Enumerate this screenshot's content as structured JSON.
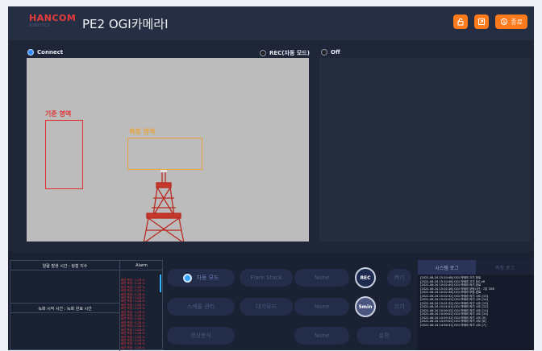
{
  "app": {
    "logo_text": "HANCOM",
    "logo_sub": "ROBOTICS",
    "title": "PE2 OGI카메라I"
  },
  "topbar": {
    "exit_label": "종료",
    "icons": [
      "lock-icon",
      "export-icon",
      "exit-icon"
    ]
  },
  "camera": {
    "connect_label": "Connect",
    "rec_label": "REC(자동 모드)",
    "off_label": "Off",
    "ref_region_label": "기준 영역",
    "meas_region_label": "측정 영역"
  },
  "info": {
    "alarm_time_label": "알람 발생 시간 : 링겔 지수",
    "alarm_header": "Alarm",
    "record_time_label": "녹화 시작 시간 : 녹화 완료 시간",
    "alarm_items": [
      "배관 측정 : 0.28 %",
      "배관 측정 : 0.28 %",
      "배관 측정 : 0.28 %",
      "배관 측정 : 0.28 %",
      "배관 측정 : 0.28 %",
      "배관 측정 : 0.28 %",
      "배관 측정 : 0.28 %",
      "배관 측정 : 0.28 %",
      "배관 측정 : 0.28 %",
      "배관 측정 : 0.28 %",
      "배관 측정 : 0.28 %",
      "배관 측정 : 0.28 %",
      "배관 측정 : 0.28 %",
      "배관 측정 : 0.28 %",
      "배관 측정 : 0.28 %",
      "배관 측정 : 0.28 %",
      "배관 측정 : 0.28 %",
      "배관 측정 : 0.28 %",
      "배관 측정 : 0.28 %",
      "배관 측정 : 0.28 %"
    ]
  },
  "controls": {
    "auto_mode": "자동 모드",
    "flare_stack": "Flare Stack",
    "none_1": "None",
    "rec": "REC",
    "on": "켜기",
    "exposure": "스케줄 관리",
    "standby": "대기모드",
    "none_2": "None",
    "five_min": "5min",
    "off": "끄기",
    "video_analysis": "영상분석",
    "none_3": "None",
    "settings": "설정"
  },
  "log": {
    "tab_system": "시스템 로그",
    "tab_measure": "측정 로그",
    "lines": [
      "[2021-06-24 15:10:46] OGI 카메라 끄기 완료",
      "[2021-06-24 15:10:46] OGI 카메라 끄기 DO off",
      "[2021-06-24 15:02:40] OGI 카메라 켜기 완료",
      "[2021-06-24 15:02:38] OGI 카메라 부팅시간 : 7분 35초",
      "[2021-06-24 15:02:38] OGI 카메라 부팅 완료",
      "[2021-06-24 15:02:32] OGI 카메라 켜기 시도 [15]",
      "[2021-06-24 15:02:02] OGI 카메라 켜기 시도 [14]",
      "[2021-06-24 15:01:32] OGI 카메라 켜기 시도 [13]",
      "[2021-06-24 15:01:02] OGI 카메라 켜기 시도 [12]",
      "[2021-06-24 15:00:32] OGI 카메라 켜기 시도 [11]",
      "[2021-06-24 15:00:02] OGI 카메라 켜기 시도 [10]",
      "[2021-06-24 14:59:32] OGI 카메라 켜기 시도 [9]",
      "[2021-06-24 14:59:02] OGI 카메라 켜기 시도 [8]",
      "[2021-06-24 14:58:32] OGI 카메라 켜기 시도 [7]"
    ]
  },
  "colors": {
    "accent": "#ff7a1a",
    "ref_region": "#e03030",
    "meas_region": "#e8a33a",
    "status_blue": "#2d8cff"
  }
}
